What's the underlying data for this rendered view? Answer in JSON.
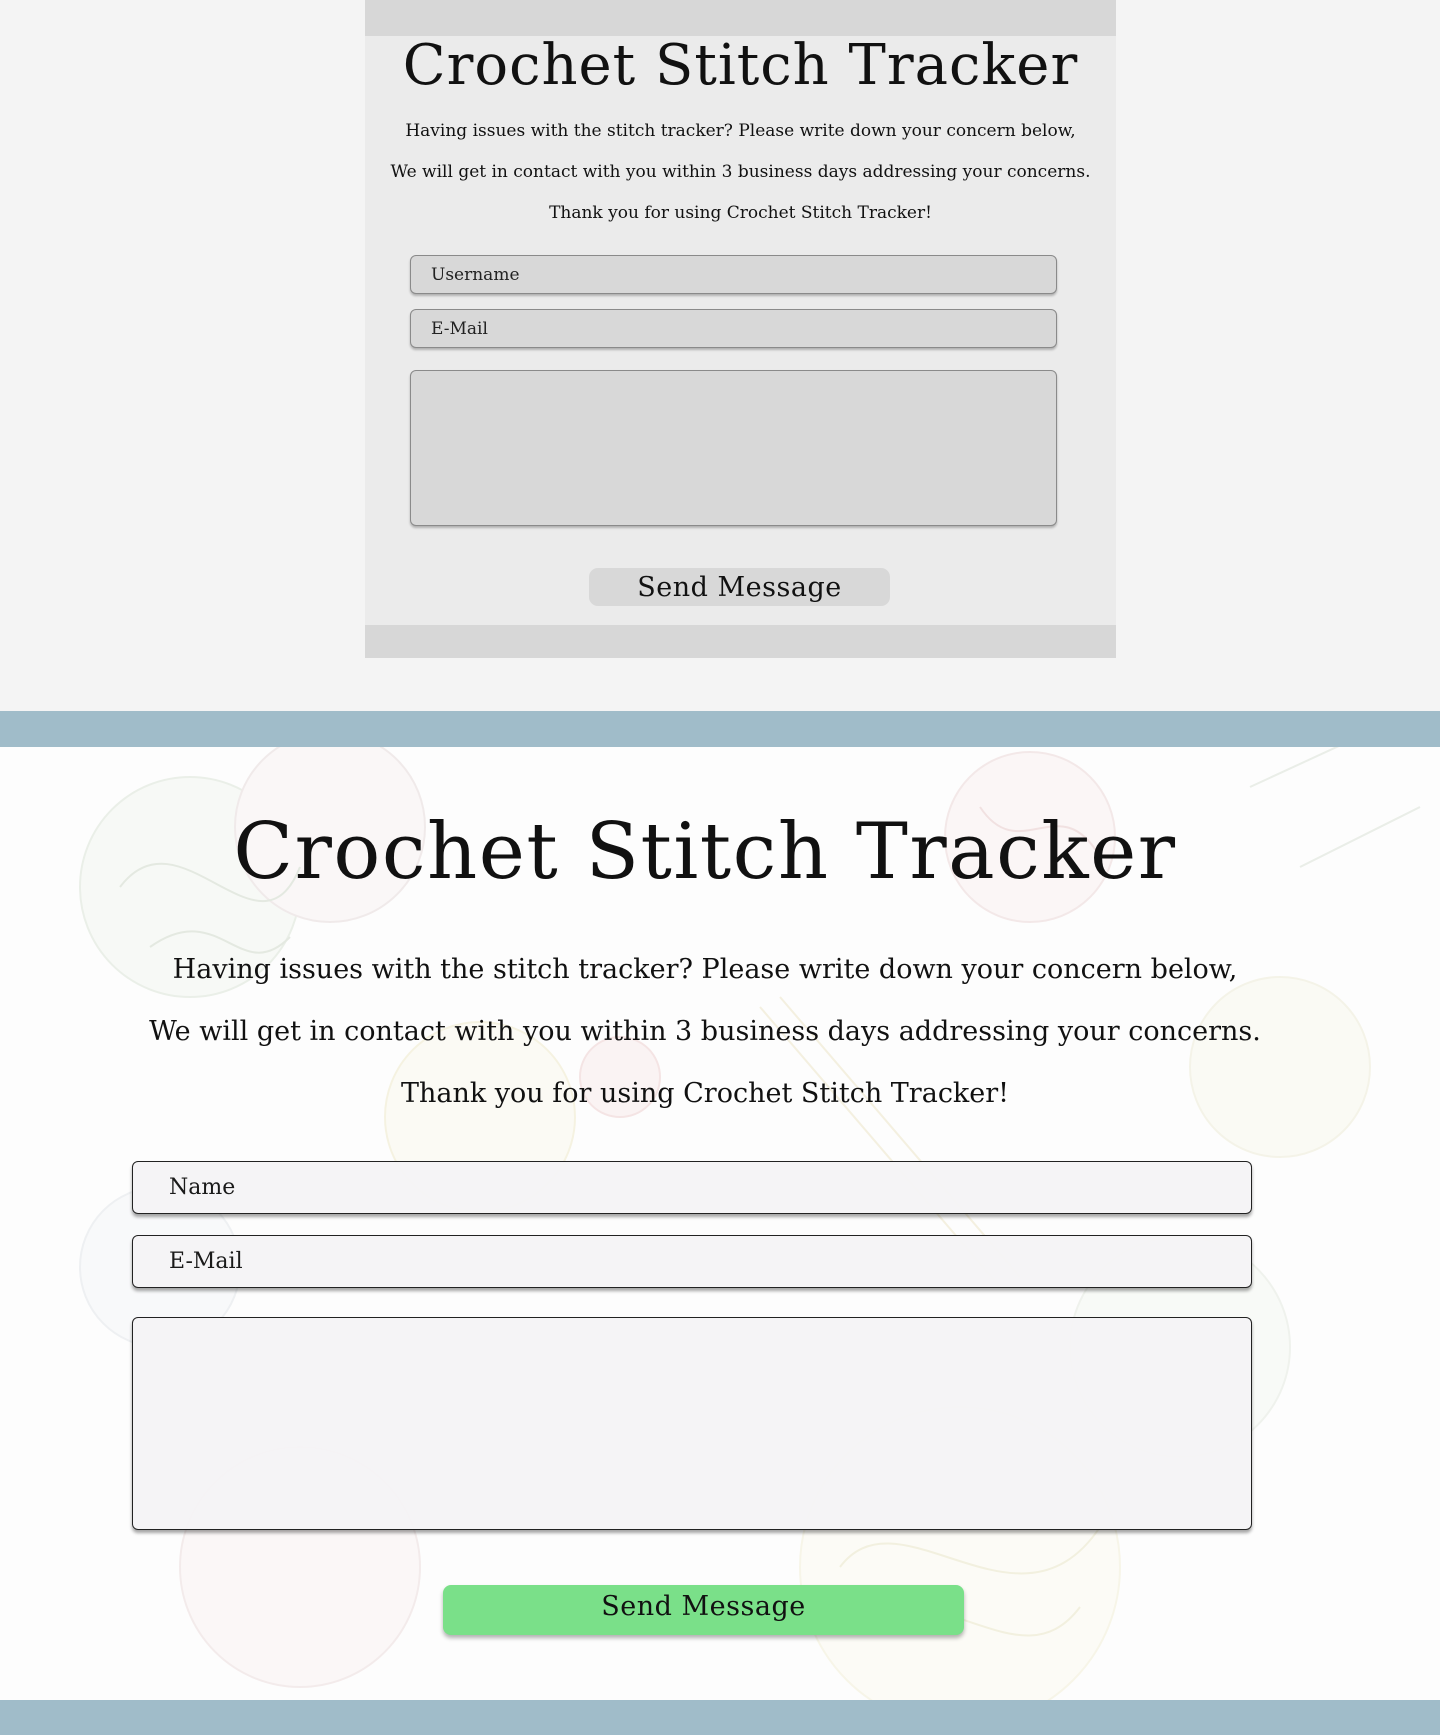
{
  "wireframe": {
    "title": "Crochet Stitch Tracker",
    "intro_lines": [
      "Having issues with the stitch tracker? Please write down your concern below,",
      "We will get in contact with you within 3 business days addressing your concerns.",
      "Thank you for using Crochet Stitch Tracker!"
    ],
    "username_placeholder": "Username",
    "email_placeholder": "E-Mail",
    "message_placeholder": "",
    "send_button_label": "Send Message"
  },
  "contact": {
    "title": "Crochet Stitch Tracker",
    "intro_lines": [
      "Having issues with the stitch tracker? Please write down your concern below,",
      "We will get in contact with you within 3 business days addressing your concerns.",
      "Thank you for using Crochet Stitch Tracker!"
    ],
    "name_placeholder": "Name",
    "email_placeholder": "E-Mail",
    "message_placeholder": "",
    "send_button_label": "Send Message"
  },
  "colors": {
    "page_background": "#f4f4f4",
    "wireframe_panel": "#ebebeb",
    "wireframe_field": "#d8d8d8",
    "stripe": "#a0bcc9",
    "send_button": "#7ae089"
  }
}
